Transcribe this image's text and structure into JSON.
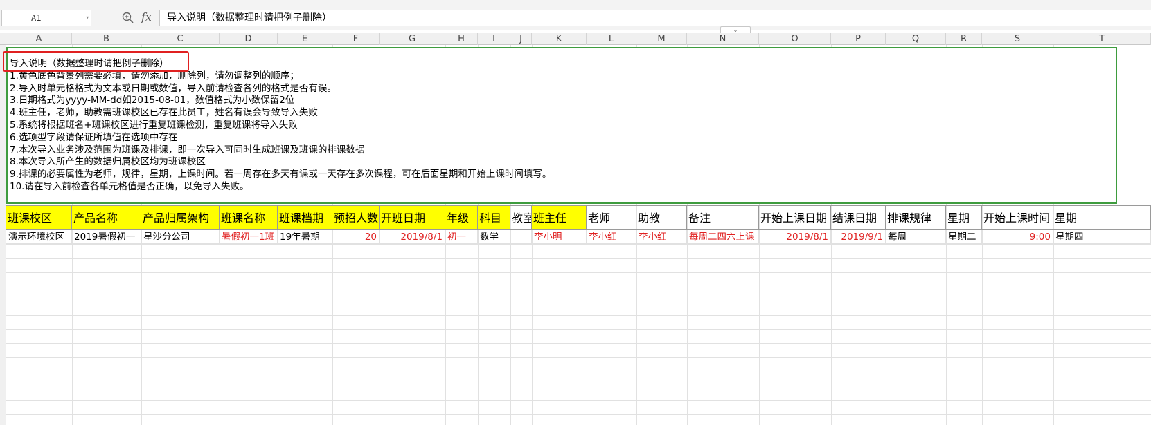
{
  "formula_bar": {
    "name_box": "A1",
    "fx_label": "fx",
    "formula": "导入说明（数据整理时请把例子删除）"
  },
  "columns": [
    "A",
    "B",
    "C",
    "D",
    "E",
    "F",
    "G",
    "H",
    "I",
    "J",
    "K",
    "L",
    "M",
    "N",
    "O",
    "P",
    "Q",
    "R",
    "S",
    "T"
  ],
  "instructions": {
    "title": "导入说明（数据整理时请把例子删除）",
    "lines": [
      "1.黄色底色背景列需要必填，请勿添加，删除列，请勿调整列的顺序；",
      "2.导入时单元格格式为文本或日期或数值，导入前请检查各列的格式是否有误。",
      "3.日期格式为yyyy-MM-dd如2015-08-01，数值格式为小数保留2位",
      "4.班主任，老师，助教需班课校区已存在此员工，姓名有误会导致导入失败",
      "5.系统将根据班名+班课校区进行重复班课检测，重复班课将导入失败",
      "6.选项型字段请保证所填值在选项中存在",
      "7.本次导入业务涉及范围为班课及排课，即一次导入可同时生成班课及班课的排课数据",
      "8.本次导入所产生的数据归属校区均为班课校区",
      "9.排课的必要属性为老师，规律，星期，上课时间。若一周存在多天有课或一天存在多次课程，可在后面星期和开始上课时间填写。",
      "10.请在导入前检查各单元格值是否正确，以免导入失败。"
    ]
  },
  "headers": [
    "班课校区",
    "产品名称",
    "产品归属架构",
    "班课名称",
    "班课档期",
    "预招人数",
    "开班日期",
    "年级",
    "科目",
    "教室",
    "班主任",
    "老师",
    "助教",
    "备注",
    "开始上课日期",
    "结课日期",
    "排课规律",
    "星期",
    "开始上课时间",
    "星期"
  ],
  "row1": [
    "演示环境校区",
    "2019暑假初一",
    "星沙分公司",
    "暑假初一1班",
    "19年暑期",
    "20",
    "2019/8/1",
    "初一",
    "数学",
    "",
    "李小明",
    "李小红",
    "李小红",
    "每周二四六上课",
    "2019/8/1",
    "2019/9/1",
    "每周",
    "星期二",
    "9:00",
    "星期四"
  ],
  "colors": {
    "required_header": "#ffff00",
    "selection_border": "#3e9c3e",
    "annotation_box": "#e02020",
    "red_text": "#e02020"
  }
}
